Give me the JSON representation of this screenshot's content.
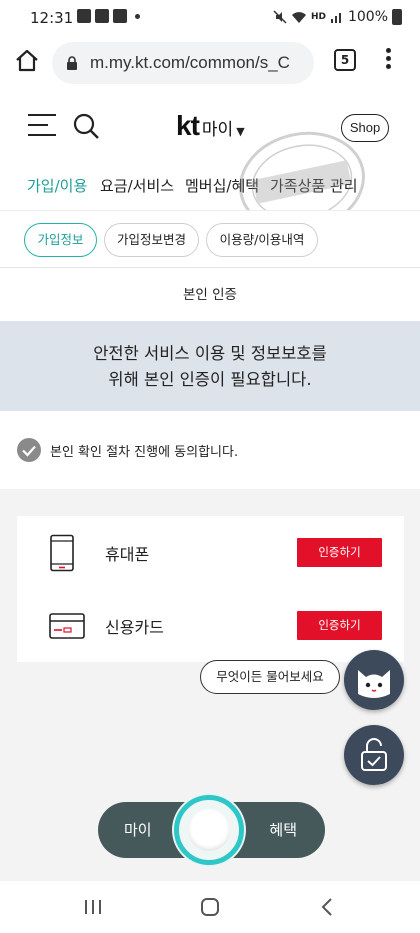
{
  "status_bar": {
    "time": "12:31",
    "network": "HD",
    "battery": "100%"
  },
  "browser": {
    "url": "m.my.kt.com/common/s_C",
    "tab_count": "5"
  },
  "header": {
    "logo_text": "kt",
    "logo_sub": "마이",
    "shop_label": "Shop"
  },
  "menu": {
    "items": [
      "가입/이용",
      "요금/서비스",
      "멤버십/혜택",
      "가족상품 관리"
    ]
  },
  "subtabs": [
    "가입정보",
    "가입정보변경",
    "이용량/이용내역"
  ],
  "page": {
    "title": "본인 인증",
    "notice_line1": "안전한 서비스 이용 및 정보보호를",
    "notice_line2": "위해 본인 인증이 필요합니다.",
    "agree_text": "본인 확인 절차 진행에 동의합니다."
  },
  "auth_methods": [
    {
      "label": "휴대폰",
      "button": "인증하기"
    },
    {
      "label": "신용카드",
      "button": "인증하기"
    }
  ],
  "chatbot": {
    "bubble": "무엇이든 물어보세요"
  },
  "bottom_nav": {
    "left": "마이",
    "right": "혜택"
  },
  "colors": {
    "accent": "#1e9e98",
    "brand_red": "#e3102a",
    "notice_bg": "#dde3ea",
    "nav_bg": "#46595a"
  }
}
